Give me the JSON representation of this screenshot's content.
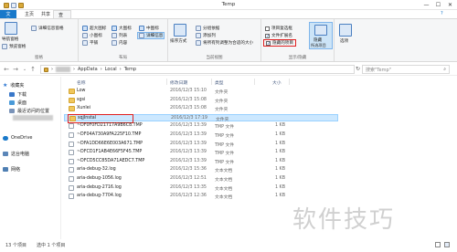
{
  "window": {
    "title": "Temp",
    "controls": {
      "minimize": "—",
      "maximize": "☐",
      "close": "✕"
    }
  },
  "ribbon": {
    "tabs": [
      "文件",
      "主页",
      "共享",
      "查看"
    ],
    "active_tab": "查看",
    "groups": {
      "panes": {
        "label": "窗格",
        "nav_pane": "导航窗格",
        "preview_pane": "预览窗格",
        "details_pane": "详细信息窗格"
      },
      "layout": {
        "label": "布局",
        "items": [
          "超大图标",
          "大图标",
          "中图标",
          "小图标",
          "列表",
          "详细信息",
          "平铺",
          "内容"
        ],
        "selected": "详细信息"
      },
      "current_view": {
        "label": "当前视图",
        "sort_by": "排序方式",
        "group_by": "分组依据",
        "add_columns": "添加列",
        "size_all_columns": "将所有列调整为合适的大小"
      },
      "show_hide": {
        "label": "显示/隐藏",
        "item_checkboxes": "项目复选框",
        "file_extensions": "文件扩展名",
        "hidden_items": "隐藏的项目",
        "hide_selected": "隐藏",
        "hide_selected_sub": "所选项目",
        "options": "选项",
        "checked": {
          "item_checkboxes": false,
          "file_extensions": true,
          "hidden_items": true
        }
      }
    }
  },
  "address": {
    "path": [
      "AppData",
      "Local",
      "Temp"
    ],
    "search_placeholder": "搜索\"Temp\""
  },
  "nav_pane": {
    "quick_access": "收藏夹",
    "items": [
      "下载",
      "桌面",
      "最近访问的位置"
    ],
    "onedrive": "OneDrive",
    "this_pc": "这台电脑",
    "network": "网络"
  },
  "file_list": {
    "columns": [
      "名称",
      "修改日期",
      "类型",
      "大小"
    ],
    "rows": [
      {
        "name": "Low",
        "date": "2016/12/3 15:10",
        "type": "文件夹",
        "size": "",
        "kind": "folder"
      },
      {
        "name": "sgsi",
        "date": "2016/12/3 15:08",
        "type": "文件夹",
        "size": "",
        "kind": "folder"
      },
      {
        "name": "Xunlei",
        "date": "2016/12/3 15:08",
        "type": "文件夹",
        "size": "",
        "kind": "folder"
      },
      {
        "name": "sqjInstal",
        "date": "2016/12/3 17:19",
        "type": "文件夹",
        "size": "",
        "kind": "folder",
        "selected": true
      },
      {
        "name": "~DF0F0FD21717A9B6C8.TMP",
        "date": "2016/12/3 13:39",
        "type": "TMP 文件",
        "size": "1 KB",
        "kind": "file"
      },
      {
        "name": "~DF04A730A9FA225F10.TMP",
        "date": "2016/12/3 13:39",
        "type": "TMP 文件",
        "size": "1 KB",
        "kind": "file"
      },
      {
        "name": "~DFA1DD66E6E003A671.TMP",
        "date": "2016/12/3 13:39",
        "type": "TMP 文件",
        "size": "1 KB",
        "kind": "file"
      },
      {
        "name": "~DFCD1F1AB4E66F5F45.TMP",
        "date": "2016/12/3 13:39",
        "type": "TMP 文件",
        "size": "1 KB",
        "kind": "file"
      },
      {
        "name": "~DFCD5CC85DA71AEDC7.TMP",
        "date": "2016/12/3 13:39",
        "type": "TMP 文件",
        "size": "1 KB",
        "kind": "file"
      },
      {
        "name": "aria-debug-32.log",
        "date": "2016/12/3 15:36",
        "type": "文本文档",
        "size": "1 KB",
        "kind": "file"
      },
      {
        "name": "aria-debug-1056.log",
        "date": "2016/12/3 12:51",
        "type": "文本文档",
        "size": "1 KB",
        "kind": "file"
      },
      {
        "name": "aria-debug-2716.log",
        "date": "2016/12/3 13:35",
        "type": "文本文档",
        "size": "1 KB",
        "kind": "file"
      },
      {
        "name": "aria-debug-7704.log",
        "date": "2016/12/3 12:36",
        "type": "文本文档",
        "size": "1 KB",
        "kind": "file"
      }
    ]
  },
  "status": {
    "item_count": "13 个项目",
    "selected": "选中 1 个项目"
  },
  "watermark": "软件技巧",
  "colors": {
    "accent": "#1979ca",
    "highlight": "#e02020",
    "selection": "#cce8ff"
  }
}
